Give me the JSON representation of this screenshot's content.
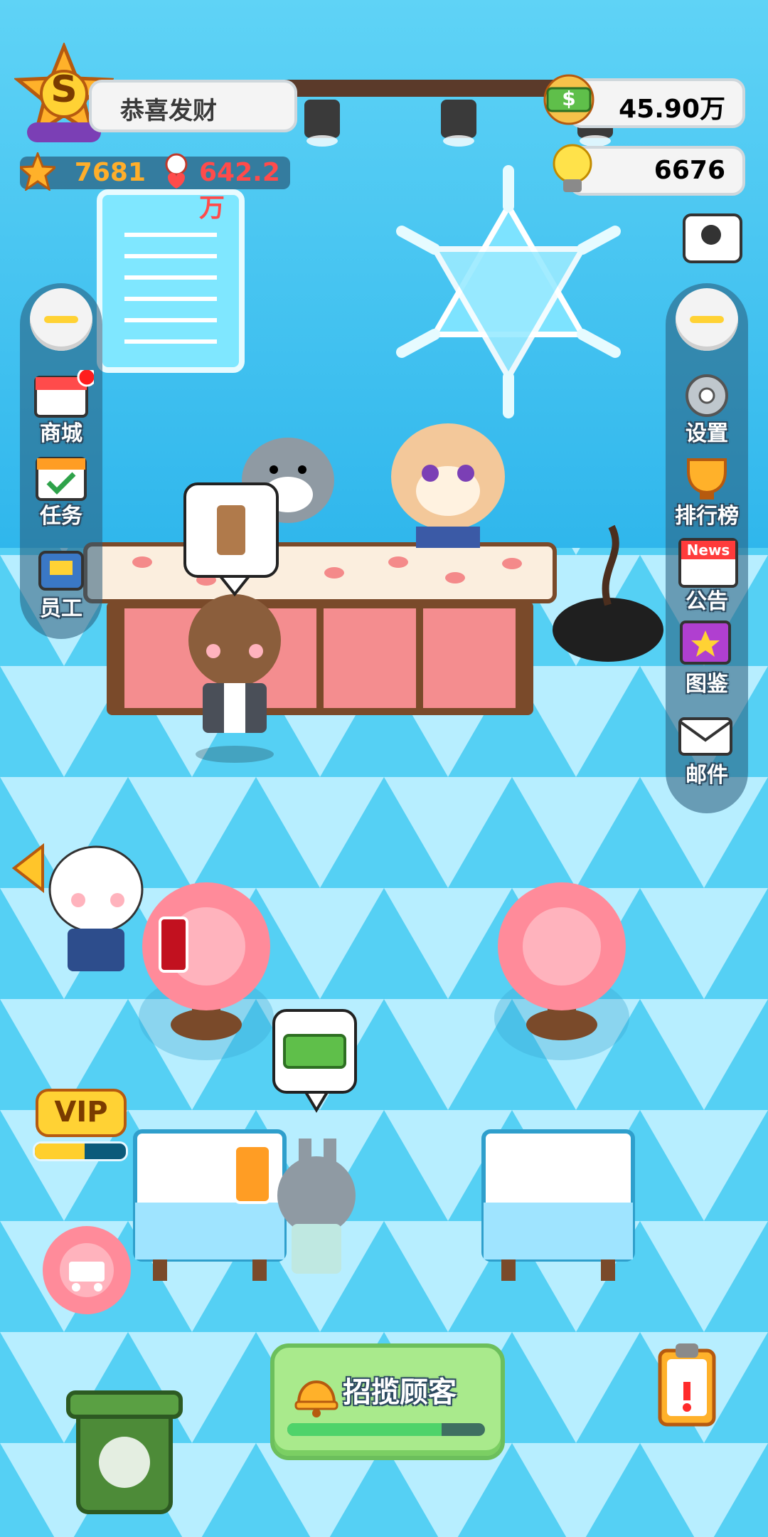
{
  "top": {
    "rank_letter": "S",
    "title": "恭喜发财",
    "stars_value": "7681",
    "fans_value": "642.2万",
    "money_value": "45.90万",
    "bulb_value": "6676",
    "money_symbol": "$"
  },
  "left_menu": [
    {
      "id": "shop",
      "label": "商城"
    },
    {
      "id": "tasks",
      "label": "任务"
    },
    {
      "id": "staff",
      "label": "员工"
    }
  ],
  "right_menu": [
    {
      "id": "settings",
      "label": "设置"
    },
    {
      "id": "ranking",
      "label": "排行榜"
    },
    {
      "id": "news",
      "label": "公告",
      "badge": "News"
    },
    {
      "id": "collection",
      "label": "图鉴"
    },
    {
      "id": "mail",
      "label": "邮件"
    }
  ],
  "vip": {
    "label": "VIP",
    "progress": 0.55
  },
  "recruit": {
    "label": "招揽顾客",
    "progress": 0.78
  },
  "bubbles": {
    "cash_symbol": "$"
  },
  "colors": {
    "sky": "#39c6f2",
    "floor_light": "#bdf1ff",
    "floor_dark": "#58d3f6",
    "accent_yellow": "#ffd234",
    "button_green": "#9ee58d"
  }
}
